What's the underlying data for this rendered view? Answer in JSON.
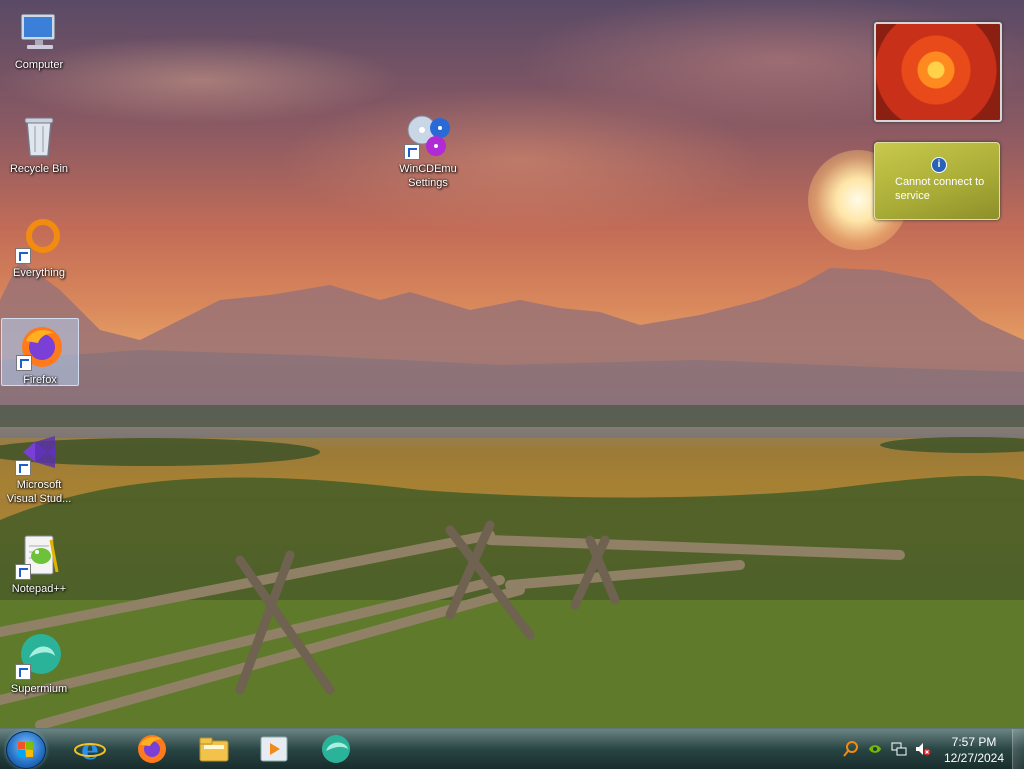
{
  "desktop": {
    "icons": [
      {
        "label": "Computer"
      },
      {
        "label": "Recycle Bin"
      },
      {
        "label": "Everything"
      },
      {
        "label": "Firefox"
      },
      {
        "label": "Microsoft Visual Stud..."
      },
      {
        "label": "Notepad++"
      },
      {
        "label": "Supermium"
      },
      {
        "label": "WinCDEmu Settings"
      }
    ]
  },
  "gadgets": {
    "weather": {
      "message": "Cannot connect to service",
      "icon": "info-icon"
    },
    "slideshow": {
      "icon": "flower-photo"
    }
  },
  "taskbar": {
    "start": {
      "icon": "windows-start-orb"
    },
    "pinned": [
      {
        "icon": "internet-explorer-icon"
      },
      {
        "icon": "firefox-icon"
      },
      {
        "icon": "file-explorer-icon"
      },
      {
        "icon": "media-player-icon"
      },
      {
        "icon": "supermium-icon"
      }
    ],
    "tray": {
      "icons": [
        "search-everything-icon",
        "nvidia-icon",
        "network-icon",
        "volume-muted-icon"
      ],
      "time": "7:57 PM",
      "date": "12/27/2024"
    }
  },
  "colors": {
    "accent": "#2a75c9",
    "taskbar": "#1e3c3a",
    "selection": "#b4cdf0"
  }
}
